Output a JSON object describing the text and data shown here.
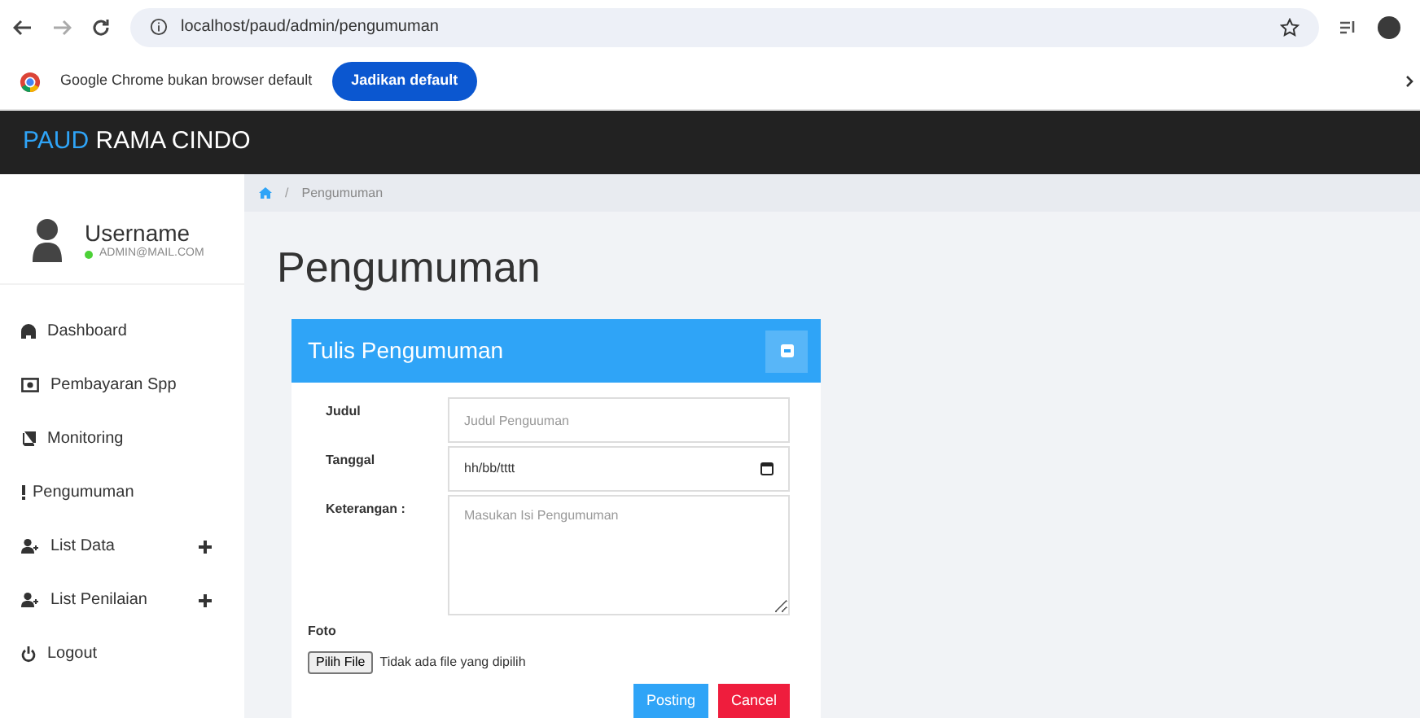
{
  "browser": {
    "url": "localhost/paud/admin/pengumuman"
  },
  "infobar": {
    "message": "Google Chrome bukan browser default",
    "button": "Jadikan default"
  },
  "brand": {
    "accent": "PAUD",
    "rest": "RAMA CINDO"
  },
  "user": {
    "name": "Username",
    "email": "ADMIN@MAIL.COM",
    "online": true
  },
  "sidebar": {
    "items": [
      {
        "label": "Dashboard",
        "expandable": false
      },
      {
        "label": "Pembayaran Spp",
        "expandable": false
      },
      {
        "label": "Monitoring",
        "expandable": false
      },
      {
        "label": "Pengumuman",
        "expandable": false
      },
      {
        "label": "List Data",
        "expandable": true
      },
      {
        "label": "List Penilaian",
        "expandable": true
      },
      {
        "label": "Logout",
        "expandable": false
      }
    ]
  },
  "breadcrumb": {
    "separator": "/",
    "current": "Pengumuman"
  },
  "page_title": "Pengumuman",
  "panel": {
    "title": "Tulis Pengumuman",
    "fields": [
      {
        "kind": "text",
        "label": "Judul",
        "placeholder": "Judul Penguuman"
      },
      {
        "kind": "date",
        "label": "Tanggal",
        "value": "hh/bb/tttt"
      },
      {
        "kind": "textarea",
        "label": "Keterangan :",
        "placeholder": "Masukan Isi Pengumuman"
      }
    ],
    "file": {
      "label": "Foto",
      "button": "Pilih File",
      "status": "Tidak ada file yang dipilih"
    },
    "buttons": [
      {
        "label": "Posting",
        "kind": "primary"
      },
      {
        "label": "Cancel",
        "kind": "danger"
      }
    ]
  }
}
